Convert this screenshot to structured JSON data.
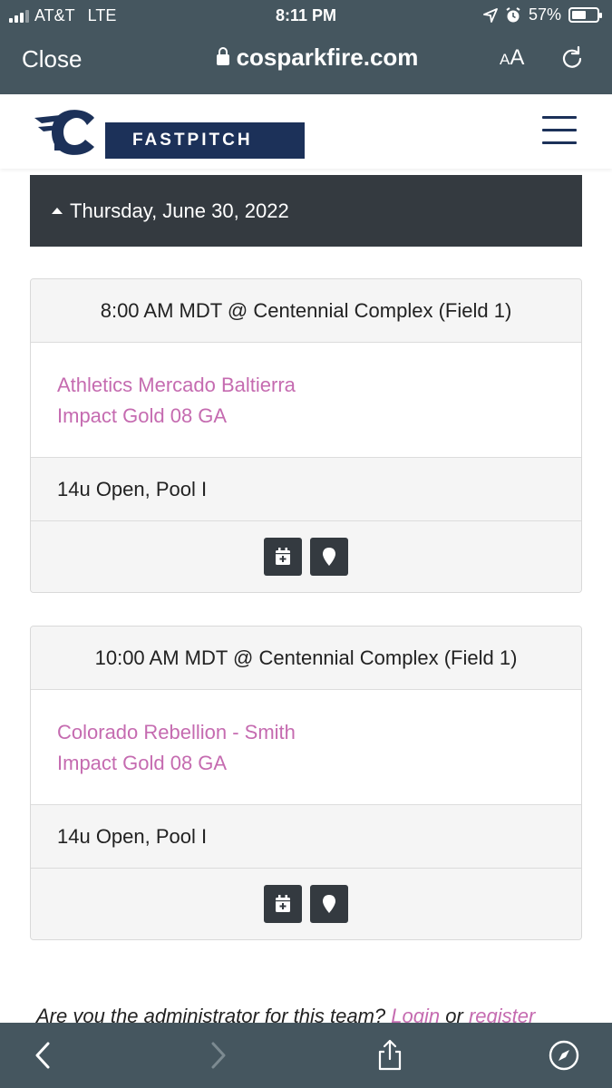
{
  "status_bar": {
    "carrier": "AT&T",
    "network": "LTE",
    "time": "8:11 PM",
    "battery": "57%",
    "battery_level": 0.57
  },
  "browser": {
    "close_label": "Close",
    "url": "cosparkfire.com",
    "text_size_label_small": "A",
    "text_size_label_large": "A"
  },
  "site": {
    "logo_text": "FASTPITCH",
    "brand_color": "#1c3159"
  },
  "schedule": {
    "date": "Thursday, June 30, 2022",
    "games": [
      {
        "time_location": "8:00 AM MDT @ Centennial Complex (Field 1)",
        "team_1": "Athletics Mercado Baltierra",
        "team_2": "Impact Gold 08 GA",
        "division": "14u Open, Pool I"
      },
      {
        "time_location": "10:00 AM MDT @ Centennial Complex (Field 1)",
        "team_1": "Colorado Rebellion - Smith",
        "team_2": "Impact Gold 08 GA",
        "division": "14u Open, Pool I"
      }
    ]
  },
  "admin": {
    "prompt": "Are you the administrator for this team? ",
    "login_label": "Login",
    "or_text": " or ",
    "register_label": "register"
  },
  "colors": {
    "chrome": "#45565f",
    "link": "#c56bb0",
    "dark_button": "#343a40"
  }
}
